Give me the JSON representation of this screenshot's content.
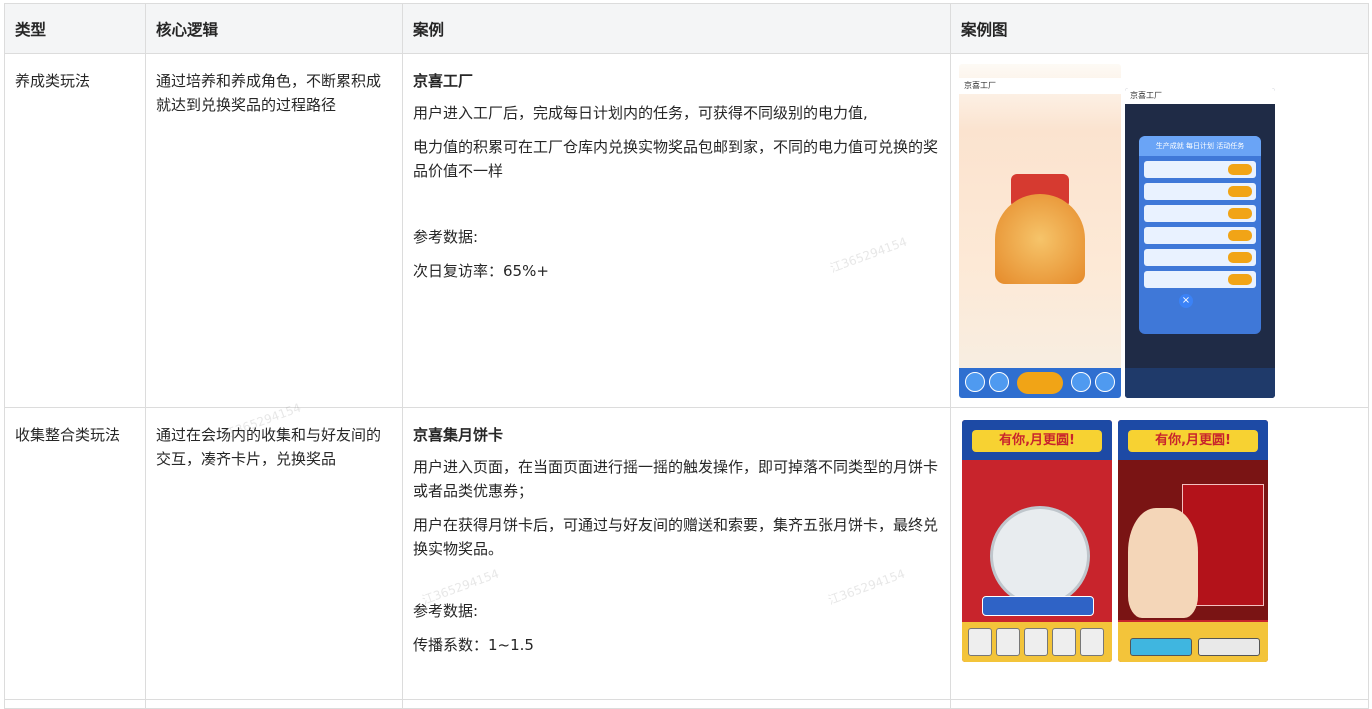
{
  "headers": {
    "type": "类型",
    "logic": "核心逻辑",
    "case": "案例",
    "image": "案例图"
  },
  "rows": [
    {
      "type": "养成类玩法",
      "logic": "通过培养和养成角色，不断累积成就达到兑换奖品的过程路径",
      "case_title": "京喜工厂",
      "paragraphs": [
        "用户进入工厂后，完成每日计划内的任务，可获得不同级别的电力值,",
        "电力值的积累可在工厂仓库内兑换实物奖品包邮到家，不同的电力值可兑换的奖品价值不一样"
      ],
      "ref_label": "参考数据:",
      "ref_value": "次日复访率：65%+",
      "phone_a_title": "京喜工厂",
      "phone_b_title": "京喜工厂",
      "dialog_tabs": "生产成就 每日计划 活动任务",
      "close_glyph": "×"
    },
    {
      "type": "收集整合类玩法",
      "logic": "通过在会场内的收集和与好友间的交互，凑齐卡片，兑换奖品",
      "case_title": "京喜集月饼卡",
      "paragraphs": [
        "用户进入页面，在当面页面进行摇一摇的触发操作，即可掉落不同类型的月饼卡或者品类优惠券；",
        "用户在获得月饼卡后，可通过与好友间的赠送和索要，集齐五张月饼卡，最终兑换实物奖品。"
      ],
      "ref_label": "参考数据:",
      "ref_value": "传播系数：1~1.5",
      "banner_a": "有你,月更圆!",
      "banner_b": "有你,月更圆!"
    }
  ],
  "watermark": "江365294154"
}
